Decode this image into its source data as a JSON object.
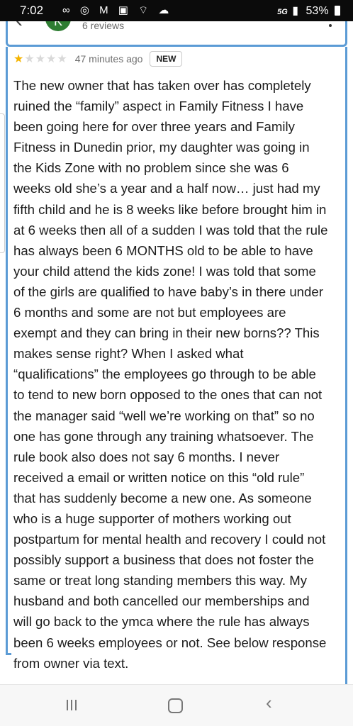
{
  "status": {
    "time": "7:02",
    "left_icons": "∞ ◎ M ▣ ⌔ ☁",
    "network": "5G",
    "battery": "53%"
  },
  "header": {
    "avatar_letter": "K",
    "review_count": "6 reviews"
  },
  "review": {
    "rating": 1,
    "max_rating": 5,
    "time_ago": "47 minutes ago",
    "badge": "NEW",
    "lines": [
      "The new owner that has taken over has completely",
      "ruined the “family” aspect in Family Fitness I have",
      "been going here for over three years and Family",
      "Fitness in Dunedin prior, my daughter was going in",
      "the Kids Zone with no problem since she was 6",
      "weeks old she’s a year and a half now… just had my",
      "fifth child and he is 8 weeks like before brought him in",
      "at 6 weeks then all of a sudden I was told that the rule",
      "has always been 6 MONTHS old to be able to have",
      "your child attend the kids zone! I was told that some",
      "of the girls are qualified to have baby’s in there under",
      "6 months and some are not but employees are",
      "exempt and they can bring in their new borns?? This",
      "makes sense right? When I asked what",
      "“qualifications” the employees go through to be able",
      "to tend to new born opposed to the ones that can not",
      "the manager said “well we’re working on that” so no",
      "one has gone through any training whatsoever. The",
      "rule book also does not say 6 months. I never",
      "received a email or written notice on this “old rule”",
      "that has suddenly become a new one. As someone",
      "who is a huge supporter of mothers working out",
      "postpartum for mental health and recovery I could not",
      "possibly support a business that does not foster the",
      "same or treat long standing members this way. My",
      "husband and both cancelled our memberships and",
      "will go back to the ymca where the rule has always",
      "been 6 weeks employees or not. See below response",
      "from owner via text."
    ]
  },
  "nav": {
    "recents_icon": "recents-icon",
    "home_icon": "home-icon",
    "back_icon": "back-icon"
  }
}
